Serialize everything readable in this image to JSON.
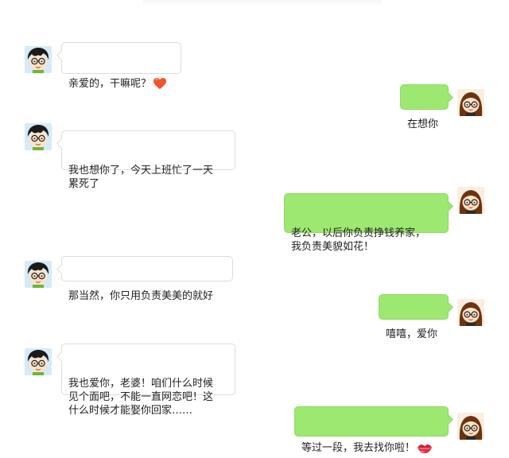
{
  "chat": {
    "messages": [
      {
        "sender": "boy",
        "avatar_icon": "boy-avatar-icon",
        "text": "亲爱的，干嘛呢？",
        "emoji": "heart-icon"
      },
      {
        "sender": "girl",
        "avatar_icon": "girl-avatar-icon",
        "text": "在想你"
      },
      {
        "sender": "boy",
        "avatar_icon": "boy-avatar-icon",
        "text": "我也想你了，今天上班忙了一天\n累死了"
      },
      {
        "sender": "girl",
        "avatar_icon": "girl-avatar-icon",
        "text": "老公，以后你负责挣钱养家，\n我负责美貌如花！"
      },
      {
        "sender": "boy",
        "avatar_icon": "boy-avatar-icon",
        "text": "那当然，你只用负责美美的就好"
      },
      {
        "sender": "girl",
        "avatar_icon": "girl-avatar-icon",
        "text": "嘻嘻，爱你"
      },
      {
        "sender": "boy",
        "avatar_icon": "boy-avatar-icon",
        "text": "我也爱你，老婆！咱们什么时候\n见个面吧，不能一直网恋吧！这\n什么时候才能娶你回家……"
      },
      {
        "sender": "girl",
        "avatar_icon": "girl-avatar-icon",
        "text": "等过一段，我去找你啦！",
        "emoji": "kiss-lips-icon"
      }
    ]
  },
  "colors": {
    "outgoing_bubble": "#9de870",
    "incoming_bubble": "#ffffff",
    "incoming_border": "#dcdcdc",
    "heart": "#f0542b",
    "lips": "#d61f33"
  }
}
